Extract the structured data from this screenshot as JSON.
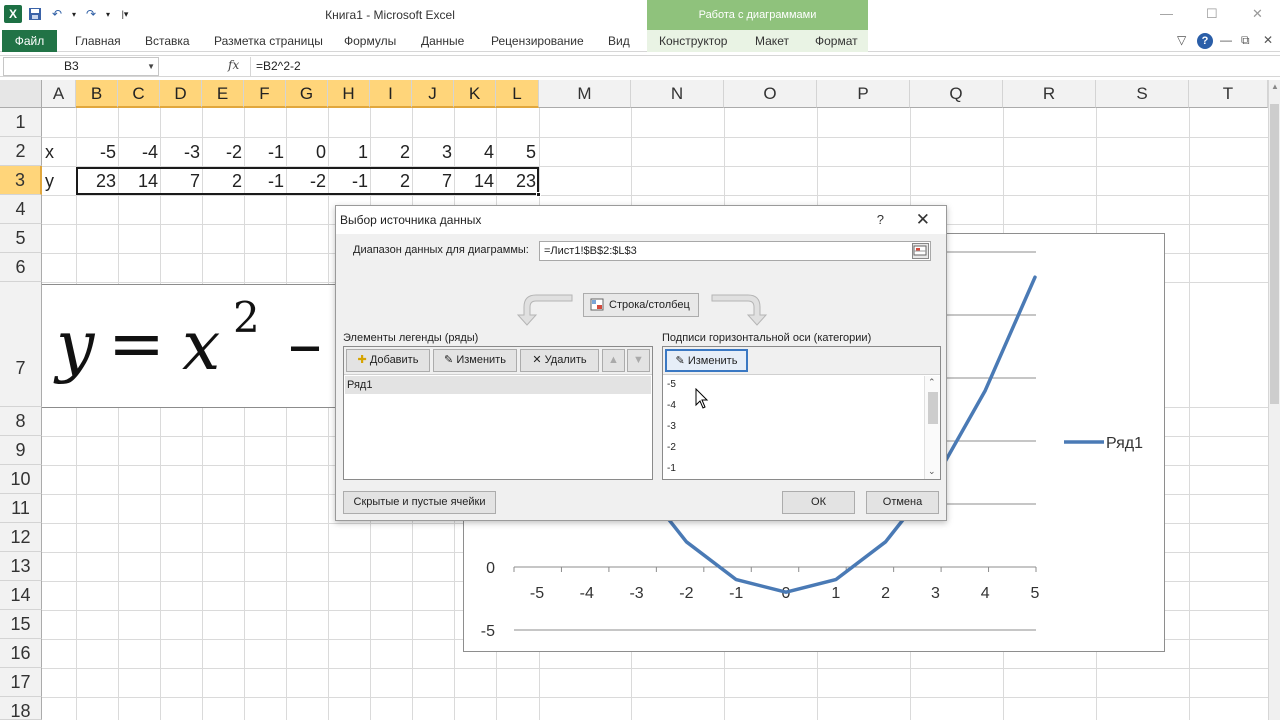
{
  "window": {
    "title": "Книга1 - Microsoft Excel",
    "context_tab": "Работа с диаграммами"
  },
  "ribbon": {
    "tabs": [
      "Файл",
      "Главная",
      "Вставка",
      "Разметка страницы",
      "Формулы",
      "Данные",
      "Рецензирование",
      "Вид",
      "Конструктор",
      "Макет",
      "Формат"
    ]
  },
  "formula_bar": {
    "name_box": "B3",
    "fx": "fx",
    "formula": "=B2^2-2"
  },
  "sheet": {
    "columns": [
      "A",
      "B",
      "C",
      "D",
      "E",
      "F",
      "G",
      "H",
      "I",
      "J",
      "K",
      "L",
      "M",
      "N",
      "O",
      "P",
      "Q",
      "R",
      "S",
      "T"
    ],
    "rows": [
      "1",
      "2",
      "3",
      "4",
      "5",
      "6",
      "7",
      "8",
      "9",
      "10",
      "11",
      "12",
      "13",
      "14",
      "15",
      "16",
      "17",
      "18"
    ],
    "row2_label": "x",
    "row2_values": [
      "-5",
      "-4",
      "-3",
      "-2",
      "-1",
      "0",
      "1",
      "2",
      "3",
      "4",
      "5"
    ],
    "row3_label": "y",
    "row3_values": [
      "23",
      "14",
      "7",
      "2",
      "-1",
      "-2",
      "-1",
      "2",
      "7",
      "14",
      "23"
    ]
  },
  "equation": {
    "y": "y",
    "eq": "=",
    "x": "x",
    "exp": "2",
    "minus": "–"
  },
  "chart_data": {
    "type": "line",
    "categories": [
      "-5",
      "-4",
      "-3",
      "-2",
      "-1",
      "0",
      "1",
      "2",
      "3",
      "4",
      "5"
    ],
    "series": [
      {
        "name": "Ряд1",
        "values": [
          23,
          14,
          7,
          2,
          -1,
          -2,
          -1,
          2,
          7,
          14,
          23
        ]
      }
    ],
    "y_tick_labels": [
      "-5",
      "0"
    ],
    "color": "#4a7ab5",
    "legend": "right",
    "grid": true
  },
  "dialog": {
    "title": "Выбор источника данных",
    "help": "?",
    "close": "✕",
    "range_label": "Диапазон данных для диаграммы:",
    "range_value": "=Лист1!$B$2:$L$3",
    "switch_button": "Строка/столбец",
    "legend_label": "Элементы легенды (ряды)",
    "axis_label": "Подписи горизонтальной оси (категории)",
    "add_button": "Добавить",
    "edit_button": "Изменить",
    "delete_button": "Удалить",
    "axis_edit_button": "Изменить",
    "series_items": [
      "Ряд1"
    ],
    "category_items": [
      "-5",
      "-4",
      "-3",
      "-2",
      "-1"
    ],
    "hidden_cells_button": "Скрытые и пустые ячейки",
    "ok_button": "ОК",
    "cancel_button": "Отмена"
  }
}
